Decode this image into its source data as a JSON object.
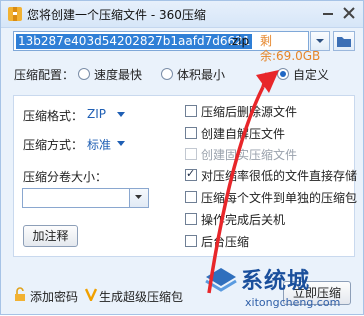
{
  "window": {
    "title": "您将创建一个压缩文件 - 360压缩"
  },
  "path": {
    "filename": "13b287e403d54202827b1aafd7d6621",
    "extension": ".zip",
    "remaining": "剩余:69.0GB"
  },
  "config": {
    "label": "压缩配置：",
    "options": [
      "速度最快",
      "体积最小",
      "自定义"
    ],
    "selected": "自定义"
  },
  "left": {
    "format_label": "压缩格式：",
    "format_value": "ZIP",
    "method_label": "压缩方式：",
    "method_value": "标准",
    "split_label": "压缩分卷大小：",
    "comment_button": "加注释"
  },
  "options": [
    {
      "label": "压缩后删除源文件",
      "checked": false,
      "disabled": false
    },
    {
      "label": "创建自解压文件",
      "checked": false,
      "disabled": false
    },
    {
      "label": "创建固实压缩文件",
      "checked": false,
      "disabled": true
    },
    {
      "label": "对压缩率很低的文件直接存储",
      "checked": true,
      "disabled": false
    },
    {
      "label": "压缩每个文件到单独的压缩包",
      "checked": false,
      "disabled": false
    },
    {
      "label": "操作完成后关机",
      "checked": false,
      "disabled": false
    },
    {
      "label": "后台压缩",
      "checked": false,
      "disabled": false
    }
  ],
  "footer": {
    "password_link": "添加密码",
    "super_link": "生成超级压缩包",
    "now_button": "立即压缩"
  },
  "watermark": {
    "brand": "系统城",
    "domain": "xitongcheng.com"
  },
  "colors": {
    "accent": "#1f67c4",
    "highlight": "#2f7fd6",
    "remain": "#e6862a",
    "arrow": "#e8262a"
  }
}
